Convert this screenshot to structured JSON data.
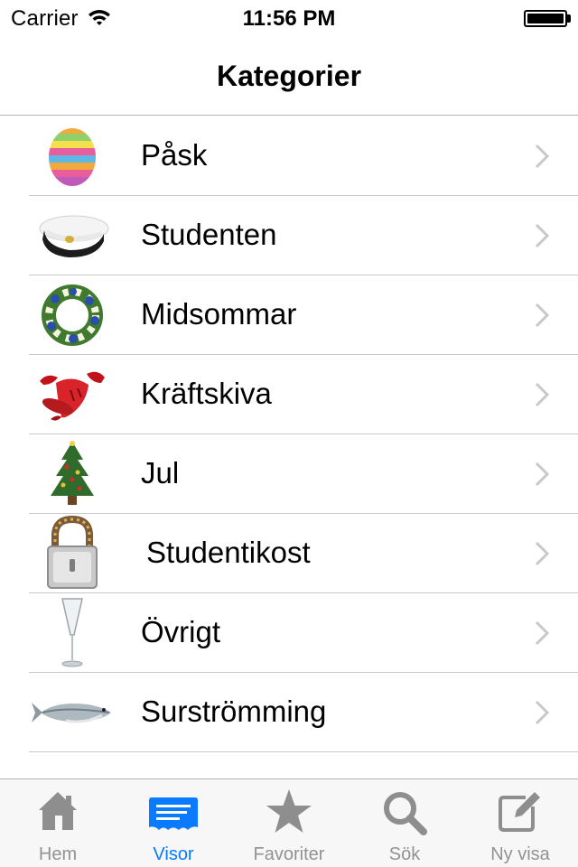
{
  "status_bar": {
    "carrier": "Carrier",
    "time": "11:56 PM"
  },
  "nav": {
    "title": "Kategorier"
  },
  "categories": [
    {
      "label": "Påsk",
      "icon": "easter-egg-icon"
    },
    {
      "label": "Studenten",
      "icon": "student-cap-icon"
    },
    {
      "label": "Midsommar",
      "icon": "flower-wreath-icon"
    },
    {
      "label": "Kräftskiva",
      "icon": "crayfish-icon"
    },
    {
      "label": "Jul",
      "icon": "christmas-tree-icon"
    },
    {
      "label": "Studentikost",
      "icon": "padlock-icon"
    },
    {
      "label": "Övrigt",
      "icon": "champagne-glass-icon"
    },
    {
      "label": "Surströmming",
      "icon": "herring-fish-icon"
    }
  ],
  "tabs": [
    {
      "label": "Hem",
      "icon": "house-icon"
    },
    {
      "label": "Visor",
      "icon": "ticket-icon",
      "active": true
    },
    {
      "label": "Favoriter",
      "icon": "star-icon"
    },
    {
      "label": "Sök",
      "icon": "search-icon"
    },
    {
      "label": "Ny visa",
      "icon": "compose-icon"
    }
  ],
  "colors": {
    "accent": "#0a7aff",
    "tab_inactive": "#929292",
    "separator": "#c8c7cc",
    "chevron": "#c7c7cc"
  }
}
